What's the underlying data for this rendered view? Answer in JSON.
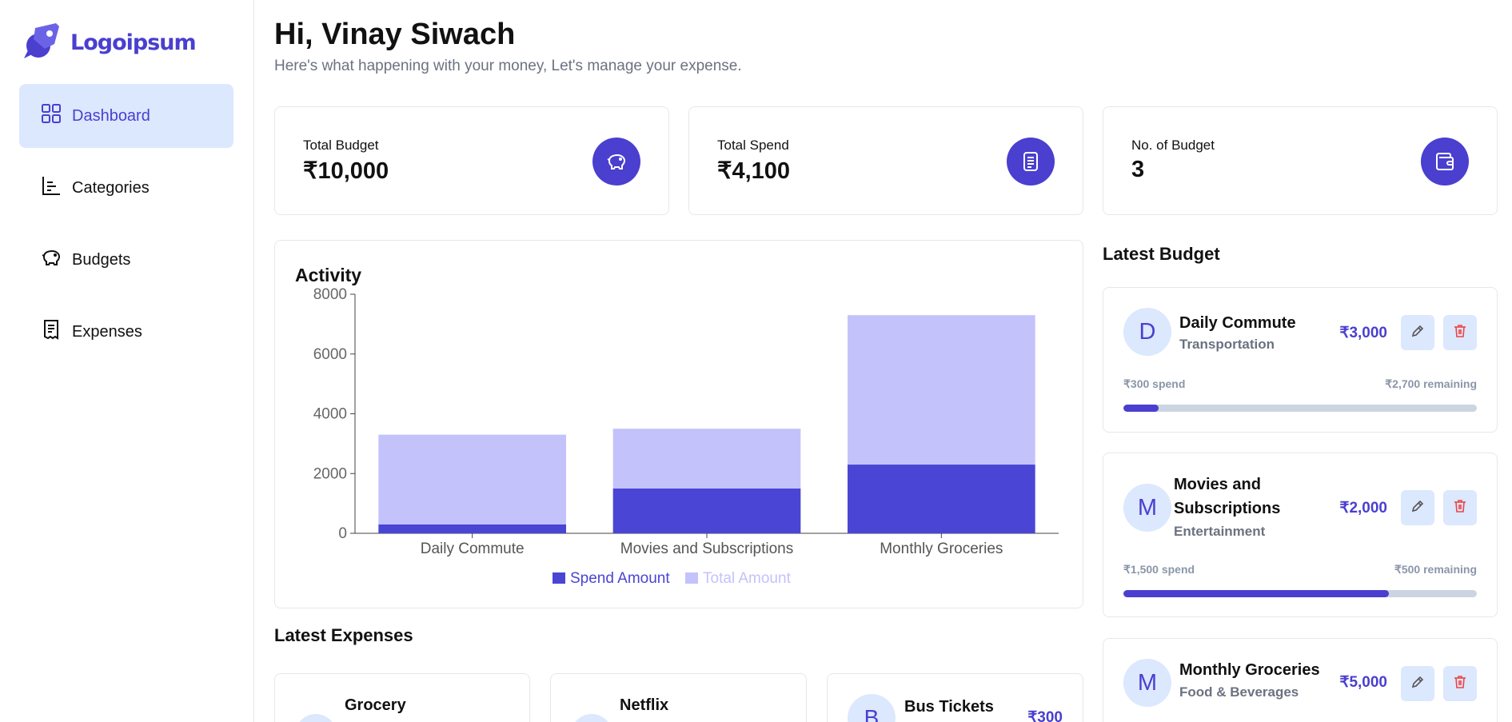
{
  "brand": {
    "name": "Logoipsum"
  },
  "sidebar": {
    "items": [
      {
        "label": "Dashboard",
        "icon": "grid-icon",
        "active": true
      },
      {
        "label": "Categories",
        "icon": "bar-chart-icon",
        "active": false
      },
      {
        "label": "Budgets",
        "icon": "piggy-bank-icon",
        "active": false
      },
      {
        "label": "Expenses",
        "icon": "receipt-icon",
        "active": false
      }
    ]
  },
  "header": {
    "greeting": "Hi, Vinay Siwach",
    "subtitle": "Here's what happening with your money, Let's manage your expense."
  },
  "stats": [
    {
      "label": "Total Budget",
      "value": "₹10,000",
      "icon": "piggy-bank-icon"
    },
    {
      "label": "Total Spend",
      "value": "₹4,100",
      "icon": "receipt-icon"
    },
    {
      "label": "No. of Budget",
      "value": "3",
      "icon": "wallet-icon"
    }
  ],
  "activity": {
    "title": "Activity"
  },
  "chart_data": {
    "type": "bar",
    "stacked": true,
    "categories": [
      "Daily Commute",
      "Movies and Subscriptions",
      "Monthly Groceries"
    ],
    "series": [
      {
        "name": "Spend Amount",
        "values": [
          300,
          1500,
          2300
        ],
        "color": "#4a45d4"
      },
      {
        "name": "Total Amount",
        "values": [
          3000,
          2000,
          5000
        ],
        "color": "#c4c2fb"
      }
    ],
    "yticks": [
      "0",
      "2000",
      "4000",
      "6000",
      "8000"
    ],
    "ylim": [
      0,
      8000
    ],
    "legend": "bottom-center"
  },
  "latest_budget": {
    "title": "Latest Budget",
    "items": [
      {
        "initial": "D",
        "name": "Daily Commute",
        "category": "Transportation",
        "amount": "₹3,000",
        "spend": "₹300 spend",
        "remaining": "₹2,700 remaining",
        "progress": 0.1
      },
      {
        "initial": "M",
        "name": "Movies and Subscriptions",
        "category": "Entertainment",
        "amount": "₹2,000",
        "spend": "₹1,500 spend",
        "remaining": "₹500 remaining",
        "progress": 0.75
      },
      {
        "initial": "M",
        "name": "Monthly Groceries",
        "category": "Food & Beverages",
        "amount": "₹5,000",
        "spend": "",
        "remaining": "",
        "progress": 0
      }
    ]
  },
  "latest_expenses": {
    "title": "Latest Expenses",
    "items": [
      {
        "initial": "",
        "name": "Grocery",
        "amount": ""
      },
      {
        "initial": "",
        "name": "Netflix",
        "amount": ""
      },
      {
        "initial": "B",
        "name": "Bus Tickets",
        "amount": "₹300"
      }
    ]
  },
  "colors": {
    "accent": "#4a3fcf",
    "accent_light": "#dbe8fe",
    "danger": "#ef4444"
  }
}
